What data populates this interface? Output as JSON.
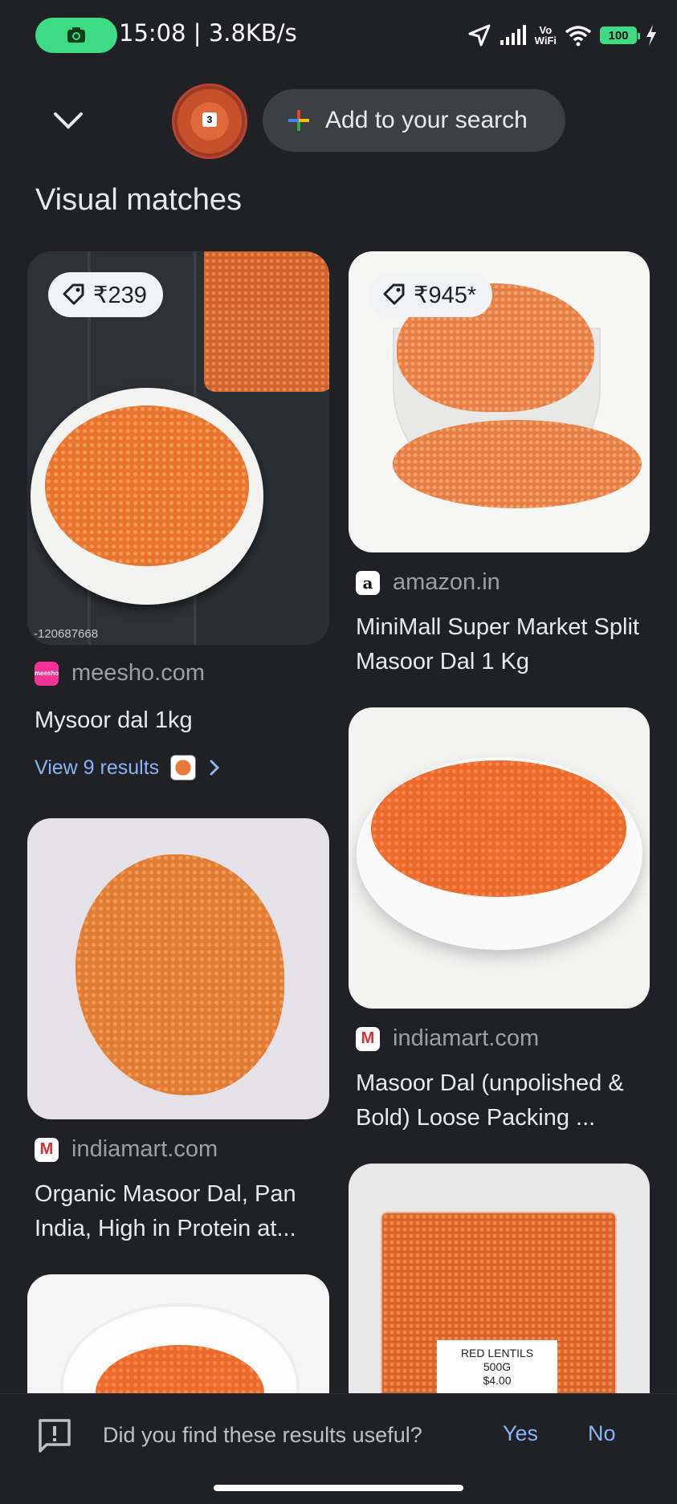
{
  "status_bar": {
    "time_speed": "15:08 | 3.8KB/s",
    "battery": "100",
    "vowifi_top": "Vo",
    "vowifi_bottom": "WiFi"
  },
  "header": {
    "thumb_badge": "3",
    "add_search_label": "Add to your search"
  },
  "section_title": "Visual matches",
  "results": [
    {
      "price": "₹239",
      "source": "meesho.com",
      "favicon_text": "meesho",
      "title": "Mysoor dal 1kg",
      "watermark": "-120687668",
      "view_results": "View 9 results"
    },
    {
      "price": "₹945*",
      "source": "amazon.in",
      "favicon_text": "a",
      "title": "MiniMall Super Market Split Masoor Dal 1 Kg"
    },
    {
      "source": "indiamart.com",
      "favicon_text": "M",
      "title": "Masoor Dal (unpolished & Bold) Loose Packing ..."
    },
    {
      "source": "indiamart.com",
      "favicon_text": "M",
      "title": "Organic Masoor Dal, Pan India, High in Protein at..."
    },
    {
      "label_line1": "RED LENTILS",
      "label_line2": "500G",
      "label_line3": "$4.00"
    }
  ],
  "feedback": {
    "question": "Did you find these results useful?",
    "yes": "Yes",
    "no": "No"
  },
  "colors": {
    "background": "#202124",
    "accent_link": "#8ab4f8",
    "lentil_orange": "#e8742f"
  }
}
